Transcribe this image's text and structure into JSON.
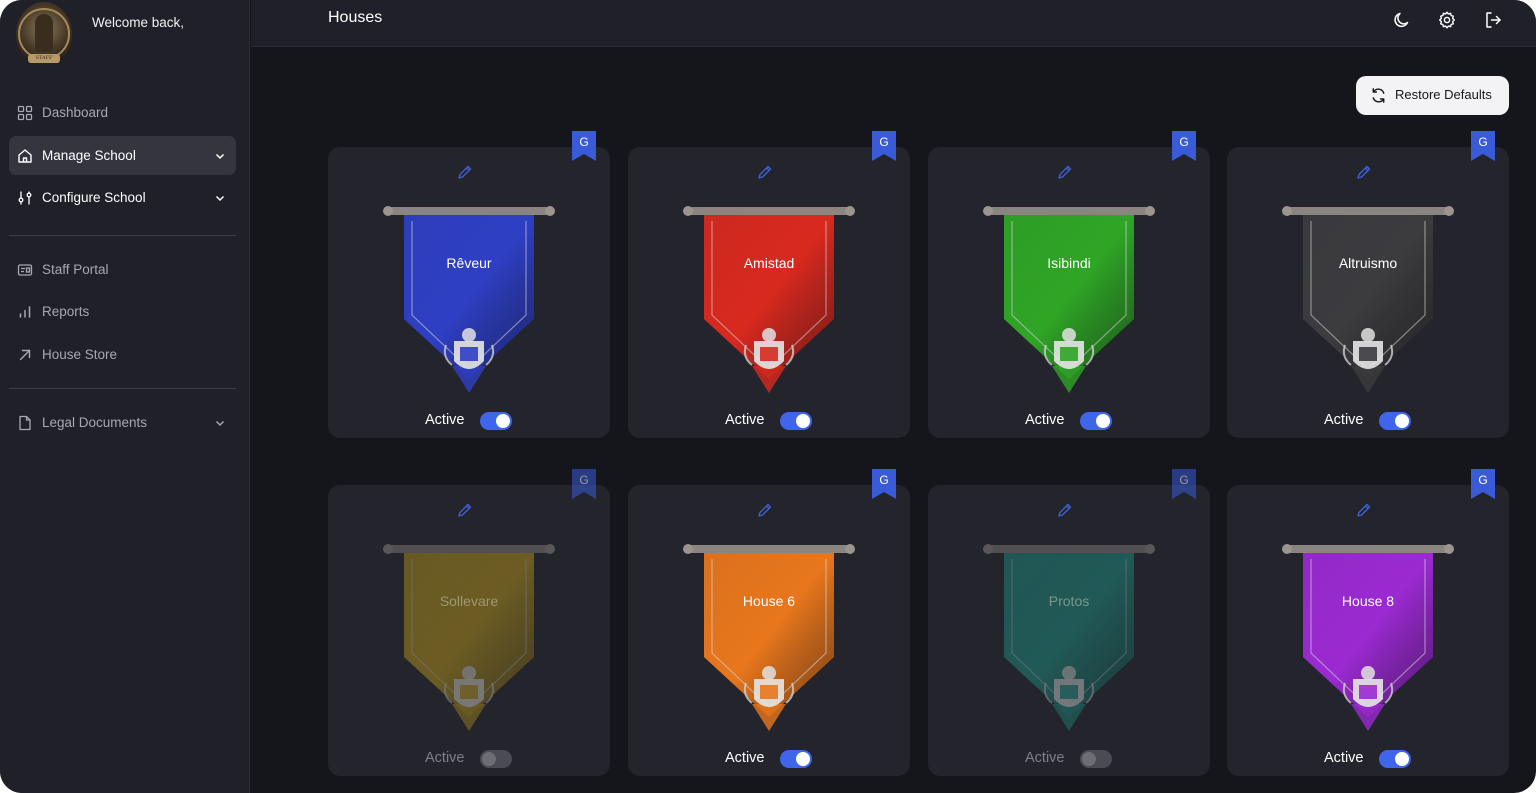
{
  "sidebar": {
    "welcome": "Welcome back,",
    "avatar_text": "STAFF",
    "items": [
      {
        "label": "Dashboard",
        "icon": "grid-icon"
      },
      {
        "label": "Manage School",
        "icon": "home-icon"
      },
      {
        "label": "Configure School",
        "icon": "sliders-icon"
      },
      {
        "label": "Staff Portal",
        "icon": "id-card-icon"
      },
      {
        "label": "Reports",
        "icon": "bar-chart-icon"
      },
      {
        "label": "House Store",
        "icon": "arrow-up-right-icon"
      },
      {
        "label": "Legal Documents",
        "icon": "document-icon"
      }
    ]
  },
  "header": {
    "title": "Houses",
    "icons": [
      "moon-icon",
      "gear-icon",
      "logout-icon"
    ]
  },
  "toolbar": {
    "restore_label": "Restore Defaults"
  },
  "houses": [
    {
      "name": "Rêveur",
      "status_label": "Active",
      "active": true,
      "color": "#2f3fc4"
    },
    {
      "name": "Amistad",
      "status_label": "Active",
      "active": true,
      "color": "#d8291f"
    },
    {
      "name": "Isibindi",
      "status_label": "Active",
      "active": true,
      "color": "#2fa526"
    },
    {
      "name": "Altruismo",
      "status_label": "Active",
      "active": true,
      "color": "#3c3c3f"
    },
    {
      "name": "Sollevare",
      "status_label": "Active",
      "active": false,
      "color": "#c7a21a"
    },
    {
      "name": "House 6",
      "status_label": "Active",
      "active": true,
      "color": "#e8771d"
    },
    {
      "name": "Protos",
      "status_label": "Active",
      "active": false,
      "color": "#1f9b8c"
    },
    {
      "name": "House 8",
      "status_label": "Active",
      "active": true,
      "color": "#9b2ad1"
    }
  ],
  "colors": {
    "accent": "#3f66ea",
    "background": "#15161b",
    "panel": "#1f2028",
    "card": "#23242c"
  }
}
